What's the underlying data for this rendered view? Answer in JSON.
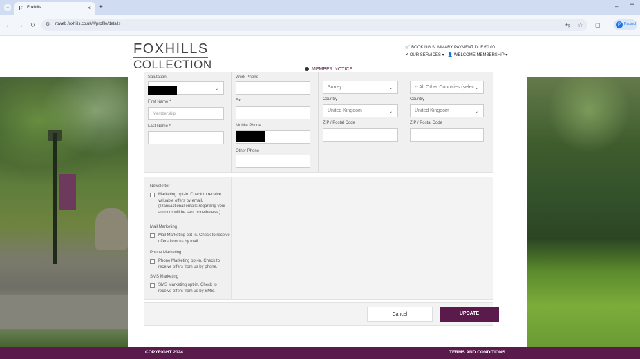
{
  "browser": {
    "tab_title": "Foxhills",
    "tab_favicon": "F",
    "tab_close": "×",
    "new_tab": "+",
    "url": "roweb.foxhills.co.uk/#/profile/details",
    "paused_label": "Paused",
    "paused_initial": "P"
  },
  "header": {
    "logo_top": "FOXHILLS",
    "logo_bottom": "COLLECTION",
    "booking_summary": "BOOKING SUMMARY",
    "payment_due": "PAYMENT DUE £0.00",
    "our_services": "OUR SERVICES",
    "welcome": "WELCOME MEMBERSHIP",
    "member_notice": "MEMBER NOTICE"
  },
  "form": {
    "col1": {
      "salutation_label": "Salutation",
      "first_name_label": "First Name *",
      "first_name_value": "Membership",
      "last_name_label": "Last Name *",
      "last_name_value": "."
    },
    "col2": {
      "work_phone_label": "Work Phone",
      "ext_label": "Ext.",
      "mobile_label": "Mobile Phone",
      "other_phone_label": "Other Phone"
    },
    "col3": {
      "county_value": "Surrey",
      "country_label": "Country",
      "country_value": "United Kingdom",
      "zip_label": "ZIP / Postal Code"
    },
    "col4": {
      "county_value": "-- All Other Countries (selec",
      "country_label": "Country",
      "country_value": "United Kingdom",
      "zip_label": "ZIP / Postal Code"
    }
  },
  "optins": {
    "newsletter_head": "Newsletter",
    "newsletter_text": "Marketing opt-in. Check to receive valuable offers by email. (Transactional emails regarding your account will be sent nonetheless.)",
    "mail_head": "Mail Marketing",
    "mail_text": "Mail Marketing opt-in. Check to receive offers from us by mail.",
    "phone_head": "Phone Marketing",
    "phone_text": "Phone Marketing opt-in. Check to receive offers from us by phone.",
    "sms_head": "SMS Marketing",
    "sms_text": "SMS Marketing opt-in. Check to receive offers from us by SMS."
  },
  "actions": {
    "cancel": "Cancel",
    "update": "UPDATE"
  },
  "footer": {
    "copyright": "COPYRIGHT 2024",
    "terms": "TERMS AND CONDITIONS"
  },
  "colors": {
    "brand": "#5b1a4c"
  }
}
